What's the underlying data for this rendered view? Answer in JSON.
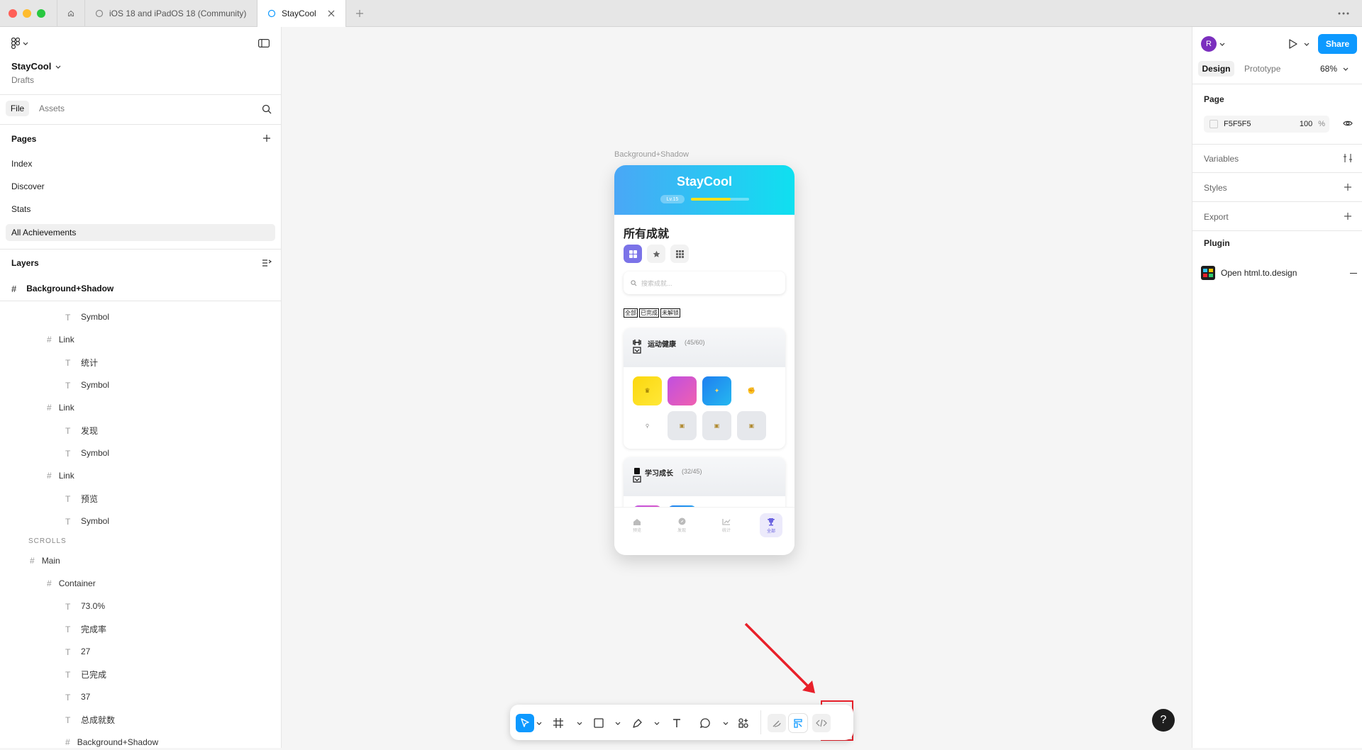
{
  "tabs": {
    "community": "iOS 18 and iPadOS 18 (Community)",
    "active": "StayCool"
  },
  "file": {
    "name": "StayCool",
    "location": "Drafts"
  },
  "left_tabs": {
    "file": "File",
    "assets": "Assets"
  },
  "pages": {
    "title": "Pages",
    "items": [
      "Index",
      "Discover",
      "Stats",
      "All Achievements"
    ]
  },
  "layers": {
    "title": "Layers",
    "frame": "Background+Shadow",
    "items": [
      "Symbol",
      "Link",
      "统计",
      "Symbol",
      "Link",
      "发现",
      "Symbol",
      "Link",
      "预览",
      "Symbol",
      "SCROLLS",
      "Main",
      "Container",
      "73.0%",
      "完成率",
      "27",
      "已完成",
      "37",
      "总成就数",
      "Background+Shadow"
    ]
  },
  "canvas": {
    "frame_label": "Background+Shadow",
    "app": {
      "title": "StayCool",
      "level": "Lv.15",
      "level_progress": 0.68,
      "heading": "所有成就",
      "search_placeholder": "搜索成就...",
      "filters": [
        "全部",
        "已完成",
        "未解锁"
      ],
      "category1": {
        "name": "运动健康",
        "count": "(45/60)"
      },
      "category2": {
        "name": "学习成长",
        "count": "(32/45)"
      },
      "nav": [
        "预览",
        "发现",
        "统计",
        "全部"
      ]
    }
  },
  "right": {
    "avatar": "R",
    "share": "Share",
    "tab_design": "Design",
    "tab_prototype": "Prototype",
    "zoom": "68%",
    "page_title": "Page",
    "page_color": "F5F5F5",
    "page_opacity": "100",
    "percent": "%",
    "variables": "Variables",
    "styles": "Styles",
    "export": "Export",
    "plugin": "Plugin",
    "plugin_item": "Open html.to.design"
  },
  "colors": {
    "accent": "#0d99ff",
    "annotation": "#e8202a",
    "avatar": "#7b2fbe"
  }
}
